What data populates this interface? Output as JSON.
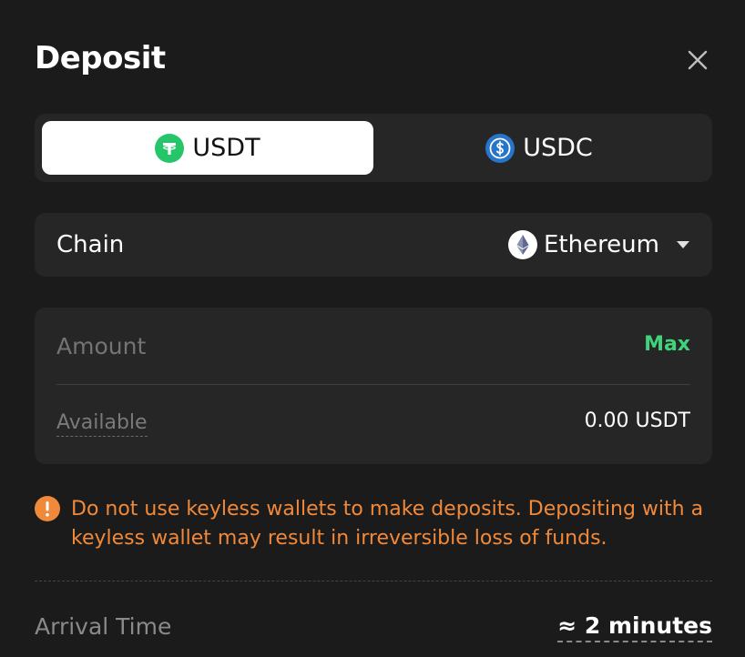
{
  "header": {
    "title": "Deposit",
    "close_icon": "close-icon"
  },
  "currency_tabs": [
    {
      "label": "USDT",
      "icon": "tether-icon",
      "color": "#26c56a",
      "selected": true
    },
    {
      "label": "USDC",
      "icon": "usdc-icon",
      "color": "#2775ca",
      "selected": false
    }
  ],
  "chain": {
    "label": "Chain",
    "value": "Ethereum",
    "icon": "ethereum-icon"
  },
  "amount": {
    "placeholder": "Amount",
    "max_label": "Max",
    "available_label": "Available",
    "available_value": "0.00 USDT"
  },
  "warning": {
    "icon": "warning-icon",
    "text": "Do not use keyless wallets to make deposits. Depositing with a keyless wallet may result in irreversible loss of funds."
  },
  "arrival": {
    "label": "Arrival Time",
    "value": "≈ 2 minutes"
  },
  "colors": {
    "background": "#1b1b1b",
    "panel": "#262626",
    "accent_green": "#3fd47b",
    "warning_orange": "#f0893a"
  }
}
